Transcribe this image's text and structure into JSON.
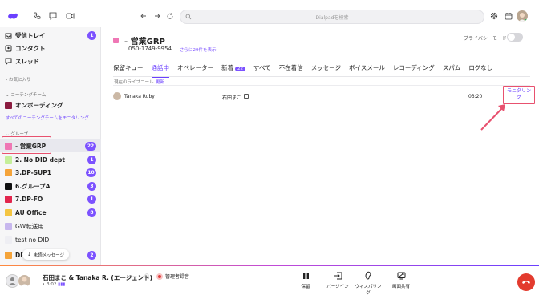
{
  "topbar": {
    "search_placeholder": "Dialpadを検索"
  },
  "sidebar": {
    "main_items": [
      {
        "label": "受信トレイ",
        "badge": "1",
        "icon": "inbox-icon"
      },
      {
        "label": "コンタクト",
        "icon": "contacts-icon"
      },
      {
        "label": "スレッド",
        "icon": "threads-icon"
      }
    ],
    "favorites_label": "お気に入り",
    "coaching_label": "コーチングチーム",
    "coaching_items": [
      {
        "label": "オンボーディング",
        "color": "#8a1b3f"
      }
    ],
    "coaching_link": "すべてのコーチングチームをモニタリング",
    "groups_label": "グループ",
    "groups": [
      {
        "label": "- 営業GRP",
        "badge": "22",
        "color": "#ef77b5"
      },
      {
        "label": "2. No DID dept",
        "badge": "1",
        "color": "#c5ef9a"
      },
      {
        "label": "3.DP-SUP1",
        "badge": "10",
        "color": "#f5a43a"
      },
      {
        "label": "6.グループA",
        "badge": "3",
        "color": "#111111"
      },
      {
        "label": "7.DP-FO",
        "badge": "1",
        "color": "#e2264d"
      },
      {
        "label": "AU Office",
        "badge": "8",
        "color": "#f4c542"
      },
      {
        "label": "GW転送用",
        "badge": "",
        "color": "#c7b7ee"
      },
      {
        "label": "test no DID",
        "badge": "",
        "color": "#eeeef3"
      },
      {
        "label": "DP-",
        "badge": "2",
        "color": "#f5a43a"
      }
    ],
    "unread_pill": "未読メッセージ"
  },
  "main": {
    "group_title": "- 営業GRP",
    "phone": "050-1749-9954",
    "more_link": "さらに29件を表示",
    "privacy_label": "プライバシーモード",
    "tabs": [
      {
        "label": "保留キュー"
      },
      {
        "label": "通話中",
        "active": true
      },
      {
        "label": "オペレーター"
      },
      {
        "label": "新着",
        "badge": "22"
      },
      {
        "label": "すべて"
      },
      {
        "label": "不在着信"
      },
      {
        "label": "メッセージ"
      },
      {
        "label": "ボイスメール"
      },
      {
        "label": "レコーディング"
      },
      {
        "label": "スパム"
      },
      {
        "label": "ログなし"
      }
    ],
    "live_label": "現在のライブコール",
    "refresh_label": "更新",
    "call": {
      "caller": "Tanaka Ruby",
      "agent": "石田まこ",
      "duration": "03:20",
      "monitor": "モニタリング"
    }
  },
  "callbar": {
    "title": "石田まこ & Tanaka R. (エージェント)",
    "recording": "管理者録音",
    "time": "3:02",
    "buttons": [
      {
        "label": "保留",
        "icon": "pause-icon"
      },
      {
        "label": "バージイン",
        "icon": "barge-in-icon"
      },
      {
        "label": "ウィスパリング",
        "icon": "whisper-icon"
      },
      {
        "label": "画面共有",
        "icon": "screen-share-icon"
      }
    ]
  },
  "colors": {
    "accent": "#6b40ff",
    "highlight": "#e8516f",
    "hangup": "#e33b2e"
  }
}
